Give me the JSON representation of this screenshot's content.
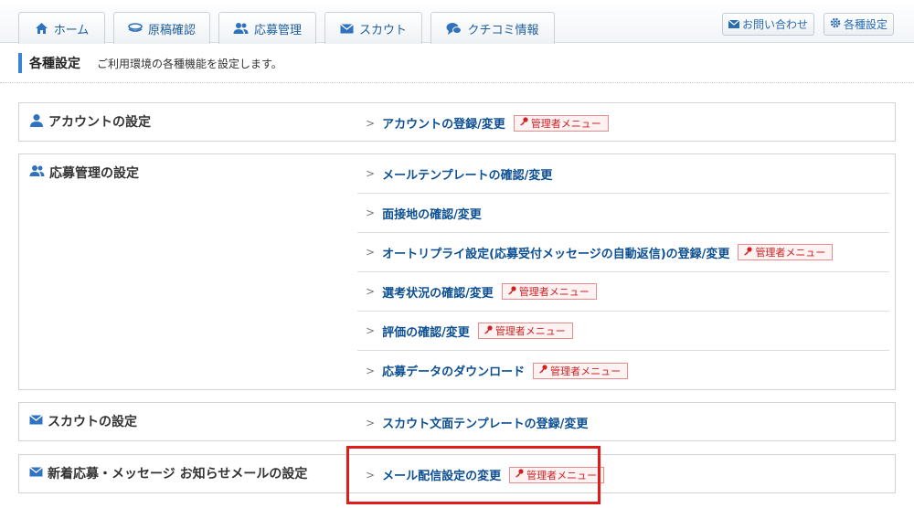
{
  "nav": {
    "tabs": [
      {
        "label": "ホーム",
        "icon": "home-icon"
      },
      {
        "label": "原稿確認",
        "icon": "stack-icon"
      },
      {
        "label": "応募管理",
        "icon": "users-icon"
      },
      {
        "label": "スカウト",
        "icon": "mail-icon"
      },
      {
        "label": "クチコミ情報",
        "icon": "chat-icon"
      }
    ],
    "contact_label": "お問い合わせ",
    "settings_label": "各種設定"
  },
  "page": {
    "title": "各種設定",
    "description": "ご利用環境の各種機能を設定します。"
  },
  "admin_badge": "管理者メニュー",
  "sections": [
    {
      "title": "アカウントの設定",
      "icon": "user-icon",
      "items": [
        {
          "label": "アカウントの登録/変更",
          "admin": true
        }
      ]
    },
    {
      "title": "応募管理の設定",
      "icon": "users-icon",
      "items": [
        {
          "label": "メールテンプレートの確認/変更",
          "admin": false
        },
        {
          "label": "面接地の確認/変更",
          "admin": false
        },
        {
          "label": "オートリプライ設定(応募受付メッセージの自動返信)の登録/変更",
          "admin": true
        },
        {
          "label": "選考状況の確認/変更",
          "admin": true
        },
        {
          "label": "評価の確認/変更",
          "admin": true
        },
        {
          "label": "応募データのダウンロード",
          "admin": true
        }
      ]
    },
    {
      "title": "スカウトの設定",
      "icon": "mail-icon",
      "items": [
        {
          "label": "スカウト文面テンプレートの登録/変更",
          "admin": false
        }
      ]
    },
    {
      "title": "新着応募・メッセージ お知らせメールの設定",
      "icon": "mail-icon",
      "items": [
        {
          "label": "メール配信設定の変更",
          "admin": true
        }
      ]
    }
  ],
  "colors": {
    "link": "#0c4f92",
    "accent": "#3a83d3",
    "badge_red": "#cc2222",
    "highlight": "#e01b1b"
  }
}
